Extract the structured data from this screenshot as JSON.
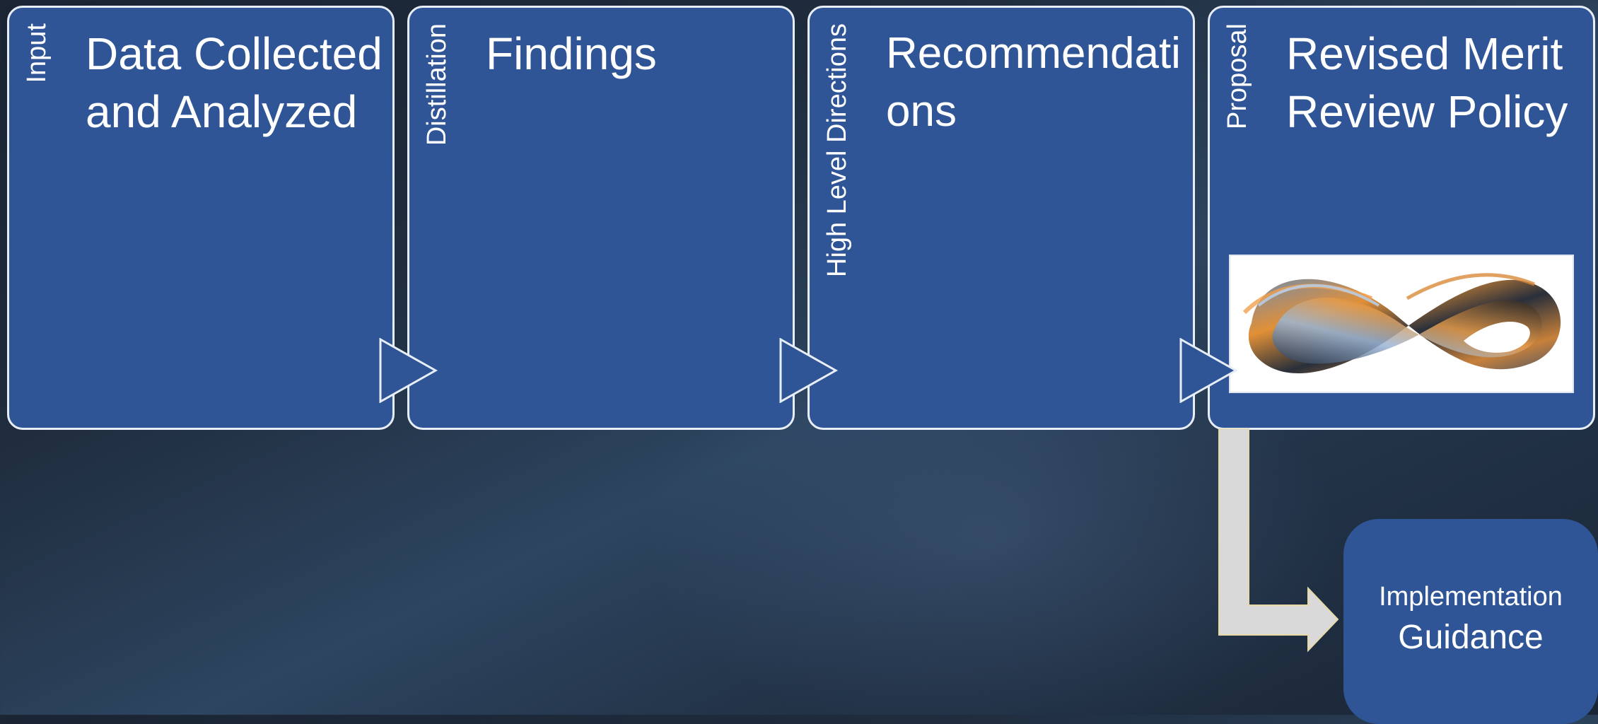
{
  "steps": [
    {
      "side_label": "Input",
      "title": "Data Collected and Analyzed"
    },
    {
      "side_label": "Distillation",
      "title": "Findings"
    },
    {
      "side_label": "High Level Directions",
      "title": "Recommendations"
    },
    {
      "side_label": "Proposal",
      "title": "Revised Merit Review Policy"
    }
  ],
  "guidance": {
    "line1": "Implementation",
    "line2": "Guidance"
  },
  "colors": {
    "box_fill": "#2f5597",
    "box_border": "#e8eef7",
    "connector_fill": "#d9d9d9",
    "connector_outline": "#e6d9a6"
  },
  "icons": {
    "arrow": "right-triangle-arrow",
    "policy_image": "infinity-ribbon-image"
  }
}
